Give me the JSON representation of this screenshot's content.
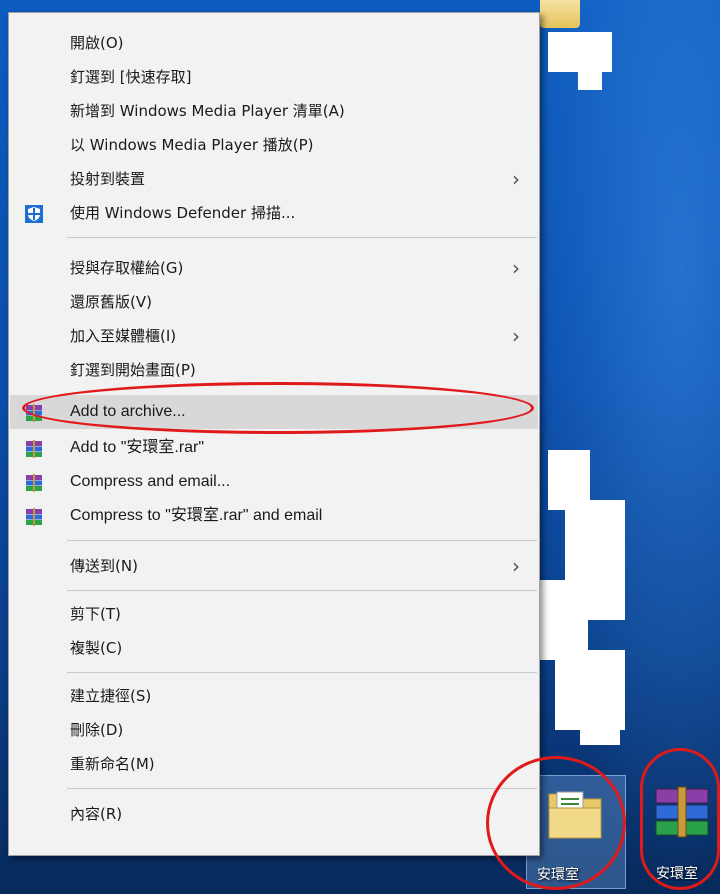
{
  "context_menu": {
    "items": [
      {
        "label": "開啟(O)"
      },
      {
        "label": "釘選到 [快速存取]"
      },
      {
        "label": "新增到 Windows Media Player 清單(A)"
      },
      {
        "label": "以 Windows Media Player 播放(P)"
      },
      {
        "label": "投射到裝置",
        "submenu": true
      },
      {
        "label": "使用 Windows Defender 掃描...",
        "icon": "windows-defender-icon"
      },
      {
        "label": "授與存取權給(G)",
        "submenu": true
      },
      {
        "label": "還原舊版(V)"
      },
      {
        "label": "加入至媒體櫃(I)",
        "submenu": true
      },
      {
        "label": "釘選到開始畫面(P)"
      },
      {
        "label": "Add to archive...",
        "icon": "winrar-icon",
        "highlighted": true
      },
      {
        "label": "Add to \"安環室.rar\"",
        "icon": "winrar-icon"
      },
      {
        "label": "Compress and email...",
        "icon": "winrar-icon"
      },
      {
        "label": "Compress to \"安環室.rar\" and email",
        "icon": "winrar-icon"
      },
      {
        "label": "傳送到(N)",
        "submenu": true
      },
      {
        "label": "剪下(T)"
      },
      {
        "label": "複製(C)"
      },
      {
        "label": "建立捷徑(S)"
      },
      {
        "label": "刪除(D)"
      },
      {
        "label": "重新命名(M)"
      },
      {
        "label": "內容(R)"
      }
    ]
  },
  "desktop": {
    "folder_icon": {
      "label": "安環室",
      "icon": "folder-icon"
    },
    "archive_icon": {
      "label": "安環室",
      "icon": "winrar-archive-icon"
    }
  },
  "annotation_color": "#e01a1a"
}
